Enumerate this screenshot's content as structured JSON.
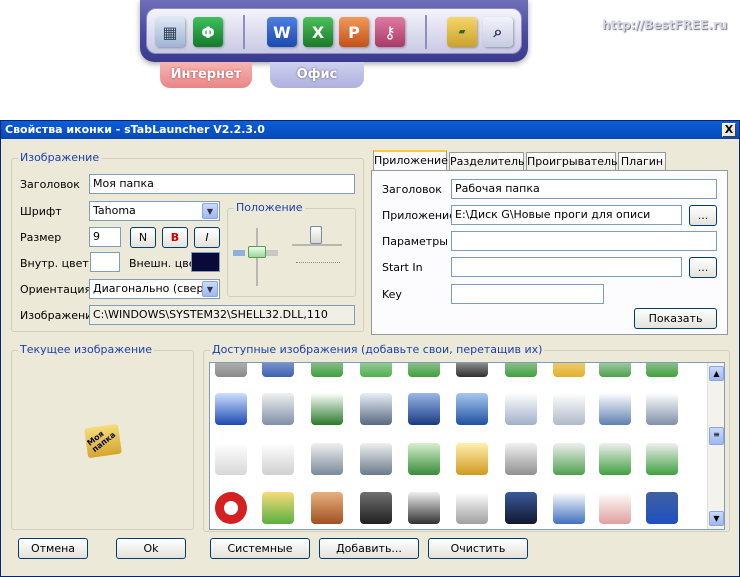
{
  "launcher": {
    "tabs": [
      "Интернет",
      "Офис"
    ],
    "watermark": "http://BestFREE.ru"
  },
  "window": {
    "title": "Свойства иконки - sTabLauncher V2.2.3.0",
    "close": "X"
  },
  "image_group": {
    "legend": "Изображение",
    "title_label": "Заголовок",
    "title_value": "Моя папка",
    "font_label": "Шрифт",
    "font_value": "Tahoma",
    "size_label": "Размер",
    "size_value": "9",
    "style_buttons": [
      "N",
      "B",
      "I"
    ],
    "inner_color_label": "Внутр. цвет",
    "outer_color_label": "Внешн. цвет",
    "inner_color": "#ffffff",
    "outer_color": "#0a0a3a",
    "orientation_label": "Ориентация",
    "orientation_value": "Диагонально (сверху",
    "image_label": "Изображение",
    "image_value": "C:\\WINDOWS\\SYSTEM32\\SHELL32.DLL,110"
  },
  "position_group": {
    "legend": "Положение"
  },
  "tabs": [
    {
      "label": "Приложение",
      "active": true
    },
    {
      "label": "Разделитель",
      "active": false
    },
    {
      "label": "Проигрыватель",
      "active": false
    },
    {
      "label": "Плагин",
      "active": false
    }
  ],
  "app_tab": {
    "title_label": "Заголовок",
    "title_value": "Рабочая папка",
    "app_label": "Приложение",
    "app_value": "E:\\Диск G\\Новые проги для описи",
    "params_label": "Параметры",
    "params_value": "",
    "start_in_label": "Start In",
    "start_in_value": "",
    "key_label": "Key",
    "key_value": "",
    "browse": "...",
    "show_button": "Показать"
  },
  "current_image": {
    "legend": "Текущее изображение",
    "icon_text": "Моя папка"
  },
  "available_images": {
    "legend": "Доступные изображения (добавьте свои, перетащив их)"
  },
  "buttons": {
    "cancel": "Отмена",
    "ok": "Ok",
    "system": "Системные",
    "add": "Добавить...",
    "clear": "Очистить"
  },
  "colors": {
    "titlebar": "#0748b8",
    "legend": "#1a3fb0",
    "window_bg": "#ece9d8"
  }
}
